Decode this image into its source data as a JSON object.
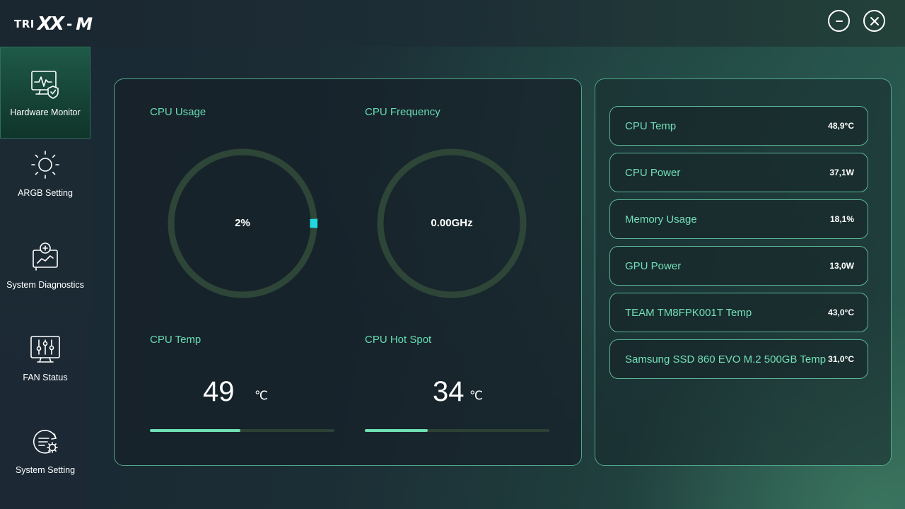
{
  "app": {
    "logo": {
      "prefix": "TRI",
      "main": "XX",
      "dash": "-",
      "suffix": "M"
    }
  },
  "window_controls": {
    "minimize": "minimize-icon",
    "close": "close-icon"
  },
  "sidebar": {
    "items": [
      {
        "label": "Hardware Monitor",
        "icon": "monitor-shield-icon",
        "active": true
      },
      {
        "label": "ARGB Setting",
        "icon": "sun-icon",
        "active": false
      },
      {
        "label": "System Diagnostics",
        "icon": "diagnostics-icon",
        "active": false
      },
      {
        "label": "FAN Status",
        "icon": "sliders-icon",
        "active": false
      },
      {
        "label": "System Setting",
        "icon": "settings-gear-icon",
        "active": false
      }
    ]
  },
  "monitor": {
    "cpu_usage": {
      "title": "CPU Usage",
      "value": "2%",
      "fraction": 0.02
    },
    "cpu_frequency": {
      "title": "CPU Frequency",
      "value": "0.00GHz",
      "fraction": 0
    },
    "cpu_temp": {
      "title": "CPU Temp",
      "value": "49",
      "unit": "℃",
      "fraction": 0.49
    },
    "cpu_hotspot": {
      "title": "CPU Hot Spot",
      "value": "34",
      "unit": "℃",
      "fraction": 0.34
    }
  },
  "sensors": [
    {
      "label": "CPU Temp",
      "value": "48,9°C"
    },
    {
      "label": "CPU Power",
      "value": "37,1W"
    },
    {
      "label": "Memory Usage",
      "value": "18,1%"
    },
    {
      "label": "GPU Power",
      "value": "13,0W"
    },
    {
      "label": "TEAM TM8FPK001T Temp",
      "value": "43,0°C"
    },
    {
      "label": "Samsung SSD 860 EVO M.2 500GB Temp",
      "value": "31,0°C"
    }
  ],
  "colors": {
    "accent": "#66ddb3",
    "gauge_track": "#2e4637",
    "gauge_fill": "#22d8e0",
    "bar_fill": "#6fe0b5"
  }
}
